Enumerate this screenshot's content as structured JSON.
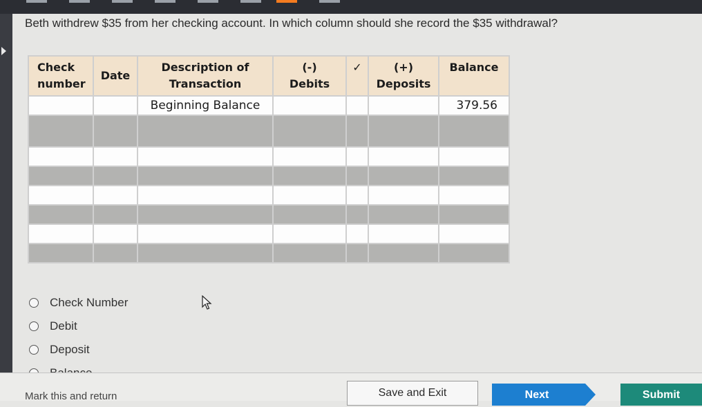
{
  "question": "Beth withdrew $35 from her checking account. In which column should she record the $35 withdrawal?",
  "table": {
    "headers": [
      [
        "Check",
        "number"
      ],
      [
        "Date"
      ],
      [
        "Description of",
        "Transaction"
      ],
      [
        "(-)",
        "Debits"
      ],
      [
        "✓"
      ],
      [
        "(+)",
        "Deposits"
      ],
      [
        "Balance"
      ]
    ],
    "first_row": {
      "description": "Beginning Balance",
      "balance": "379.56"
    },
    "colors": {
      "header_bg": "#f2e2cc",
      "shaded_row": "#b3b3b1"
    }
  },
  "options": [
    "Check Number",
    "Debit",
    "Deposit",
    "Balance"
  ],
  "footer": {
    "mark_link": "Mark this and return",
    "save_label": "Save and Exit",
    "next_label": "Next",
    "submit_label": "Submit",
    "next_color": "#1d7fd0",
    "submit_color": "#1d8a7a"
  }
}
